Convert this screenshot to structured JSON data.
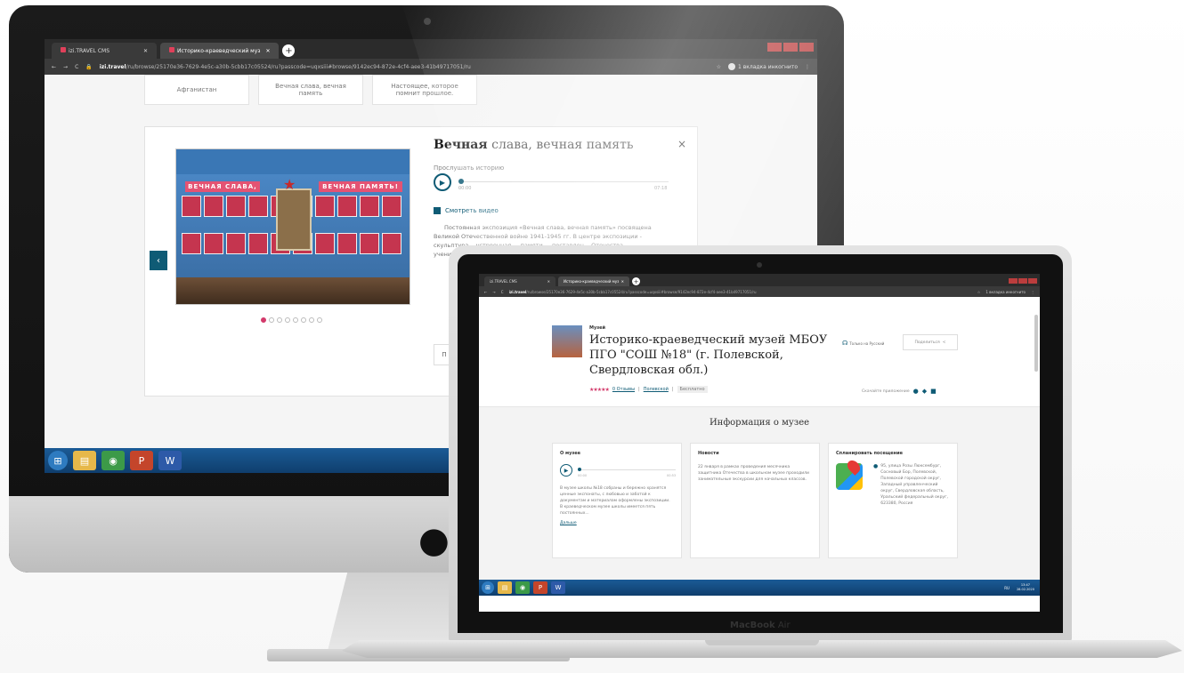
{
  "imac": {
    "browser": {
      "tabs": [
        {
          "label": "izi.TRAVEL CMS",
          "active": false
        },
        {
          "label": "Историко-краеведческий муз",
          "active": true
        }
      ],
      "new_tab": "+",
      "url_host": "izi.travel",
      "url_path": "/ru/browse/25170e36-7629-4e5c-a30b-5cbb17c05524/ru?passcode=uqxsiii#browse/9142ec94-872e-4cf4-aee3-41b49717051/ru",
      "profile": "1 вкладка инкогнито"
    },
    "category_cards": [
      "Афганистан",
      "Вечная слава, вечная память",
      "Настоящее, которое помнит прошлое."
    ],
    "popup": {
      "title_bold": "Вечная",
      "title_rest": " слава, вечная память",
      "close": "×",
      "listen_label": "Прослушать историю",
      "time_start": "00:00",
      "time_end": "07:18",
      "video_link": "Смотреть видео",
      "description": "Постоянная экспозиция «Вечная слава, вечная память» посвящена Великой Отечественной войне 1941-1945 гг. В центре экспозиции - скульптура... устроенная ... памяти ... поставлен... Отечества... учеников...",
      "banner_left": "ВЕЧНАЯ СЛАВА,",
      "banner_right": "ВЕЧНАЯ ПАМЯТЬ!",
      "prev": "‹",
      "more_btn": "П",
      "slides_total": 8,
      "slide_active": 1
    },
    "taskbar_icons": [
      "windows-start",
      "file-explorer",
      "chrome",
      "powerpoint",
      "word"
    ]
  },
  "macbook": {
    "brand_main": "MacBook",
    "brand_sub": " Air",
    "browser": {
      "tabs": [
        {
          "label": "izi.TRAVEL CMS",
          "active": false
        },
        {
          "label": "Историко-краеведческий муз",
          "active": true
        }
      ],
      "new_tab": "+",
      "url_host": "izi.travel",
      "url_path": "/ru/browse/25170e36-7629-4e5c-a30b-5cbb17c05524/ru?passcode=uqxsiii#browse/9142ec94-872e-4cf4-aee3-41b49717051/ru",
      "profile": "1 вкладка инкогнито"
    },
    "museum": {
      "kind": "Музей",
      "title": "Историко-краеведческий музей МБОУ ПГО \"СОШ №18\" (г. Полевской, Свердловская обл.)",
      "stars": "★★★★★",
      "reviews": "0 Отзывы",
      "city": "Полевской",
      "price": "Бесплатно",
      "lang": "Только на Русский",
      "share": "Поделиться",
      "apps_label": "Скачайте приложение"
    },
    "section_title": "Информация о музее",
    "cards": {
      "about": {
        "title": "О музее",
        "time_start": "00:00",
        "time_end": "00:53",
        "text": "В музее школы №18 собраны и бережно хранятся ценные экспонаты, с любовью и заботой к документам и материалам оформлены экспозиции. В краеведческом музее школы имеется пять постоянных...",
        "more": "Дальше"
      },
      "news": {
        "title": "Новости",
        "text": "22 января в рамках проведения месячника защитника Отечества в школьном музее проходили занимательные экскурсии для начальных классов."
      },
      "visit": {
        "title": "Спланировать посещение",
        "address": "95, улица Розы Люксембург, Сосновый Бор, Полевской, Полевской городской округ, Западный управленческий округ, Свердловская область, Уральский федеральный округ, 623380, Россия"
      }
    },
    "taskbar": {
      "icons": [
        "windows-start",
        "file-explorer",
        "chrome",
        "powerpoint",
        "word"
      ],
      "tray": "RU",
      "time": "13:47",
      "date": "28.02.2020"
    }
  },
  "colors": {
    "accent": "#0f5b75",
    "pink": "#d33a6b",
    "taskbar": "#1b5b96"
  }
}
